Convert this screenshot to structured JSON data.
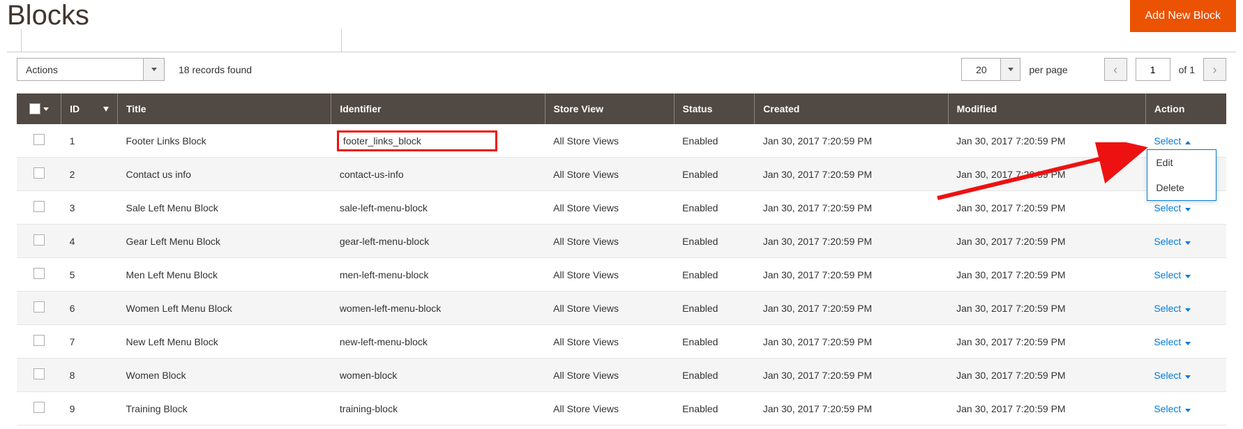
{
  "page": {
    "title": "Blocks",
    "add_button": "Add New Block"
  },
  "toolbar": {
    "actions_label": "Actions",
    "records_found": "18 records found",
    "per_page_value": "20",
    "per_page_label": "per page",
    "page_current": "1",
    "page_of_label": "of 1"
  },
  "columns": {
    "id": "ID",
    "title": "Title",
    "identifier": "Identifier",
    "store_view": "Store View",
    "status": "Status",
    "created": "Created",
    "modified": "Modified",
    "action": "Action"
  },
  "action_menu": {
    "edit": "Edit",
    "delete": "Delete"
  },
  "select_label": "Select",
  "rows": [
    {
      "id": "1",
      "title": "Footer Links Block",
      "identifier": "footer_links_block",
      "store_view": "All Store Views",
      "status": "Enabled",
      "created": "Jan 30, 2017 7:20:59 PM",
      "modified": "Jan 30, 2017 7:20:59 PM",
      "open": true,
      "highlight": true
    },
    {
      "id": "2",
      "title": "Contact us info",
      "identifier": "contact-us-info",
      "store_view": "All Store Views",
      "status": "Enabled",
      "created": "Jan 30, 2017 7:20:59 PM",
      "modified": "Jan 30, 2017 7:20:59 PM"
    },
    {
      "id": "3",
      "title": "Sale Left Menu Block",
      "identifier": "sale-left-menu-block",
      "store_view": "All Store Views",
      "status": "Enabled",
      "created": "Jan 30, 2017 7:20:59 PM",
      "modified": "Jan 30, 2017 7:20:59 PM"
    },
    {
      "id": "4",
      "title": "Gear Left Menu Block",
      "identifier": "gear-left-menu-block",
      "store_view": "All Store Views",
      "status": "Enabled",
      "created": "Jan 30, 2017 7:20:59 PM",
      "modified": "Jan 30, 2017 7:20:59 PM"
    },
    {
      "id": "5",
      "title": "Men Left Menu Block",
      "identifier": "men-left-menu-block",
      "store_view": "All Store Views",
      "status": "Enabled",
      "created": "Jan 30, 2017 7:20:59 PM",
      "modified": "Jan 30, 2017 7:20:59 PM"
    },
    {
      "id": "6",
      "title": "Women Left Menu Block",
      "identifier": "women-left-menu-block",
      "store_view": "All Store Views",
      "status": "Enabled",
      "created": "Jan 30, 2017 7:20:59 PM",
      "modified": "Jan 30, 2017 7:20:59 PM"
    },
    {
      "id": "7",
      "title": "New Left Menu Block",
      "identifier": "new-left-menu-block",
      "store_view": "All Store Views",
      "status": "Enabled",
      "created": "Jan 30, 2017 7:20:59 PM",
      "modified": "Jan 30, 2017 7:20:59 PM"
    },
    {
      "id": "8",
      "title": "Women Block",
      "identifier": "women-block",
      "store_view": "All Store Views",
      "status": "Enabled",
      "created": "Jan 30, 2017 7:20:59 PM",
      "modified": "Jan 30, 2017 7:20:59 PM"
    },
    {
      "id": "9",
      "title": "Training Block",
      "identifier": "training-block",
      "store_view": "All Store Views",
      "status": "Enabled",
      "created": "Jan 30, 2017 7:20:59 PM",
      "modified": "Jan 30, 2017 7:20:59 PM"
    }
  ]
}
